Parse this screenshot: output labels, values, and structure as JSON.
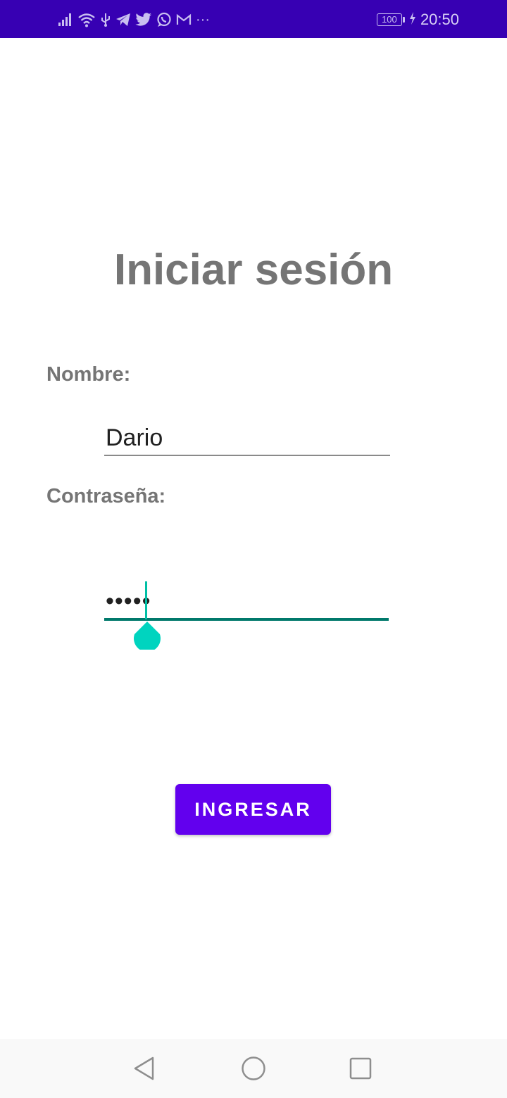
{
  "status_bar": {
    "battery": "100",
    "time": "20:50",
    "more_indicator": "···",
    "icons": [
      "signal-icon",
      "wifi-icon",
      "usb-icon",
      "telegram-icon",
      "twitter-icon",
      "whatsapp-icon",
      "gmail-icon",
      "more-notifications-icon",
      "battery-icon",
      "charging-icon"
    ]
  },
  "login": {
    "title": "Iniciar sesión",
    "name_label": "Nombre:",
    "name_value": "Dario",
    "password_label": "Contraseña:",
    "password_value": "•••••",
    "submit_label": "INGRESAR"
  },
  "navigation": {
    "icons": [
      "back-icon",
      "home-icon",
      "recents-icon"
    ]
  },
  "colors": {
    "status_bar": "#3700b3",
    "primary": "#6200ee",
    "accent": "#00bfa5",
    "focused_underline": "#00796b",
    "label_text": "#757575"
  }
}
